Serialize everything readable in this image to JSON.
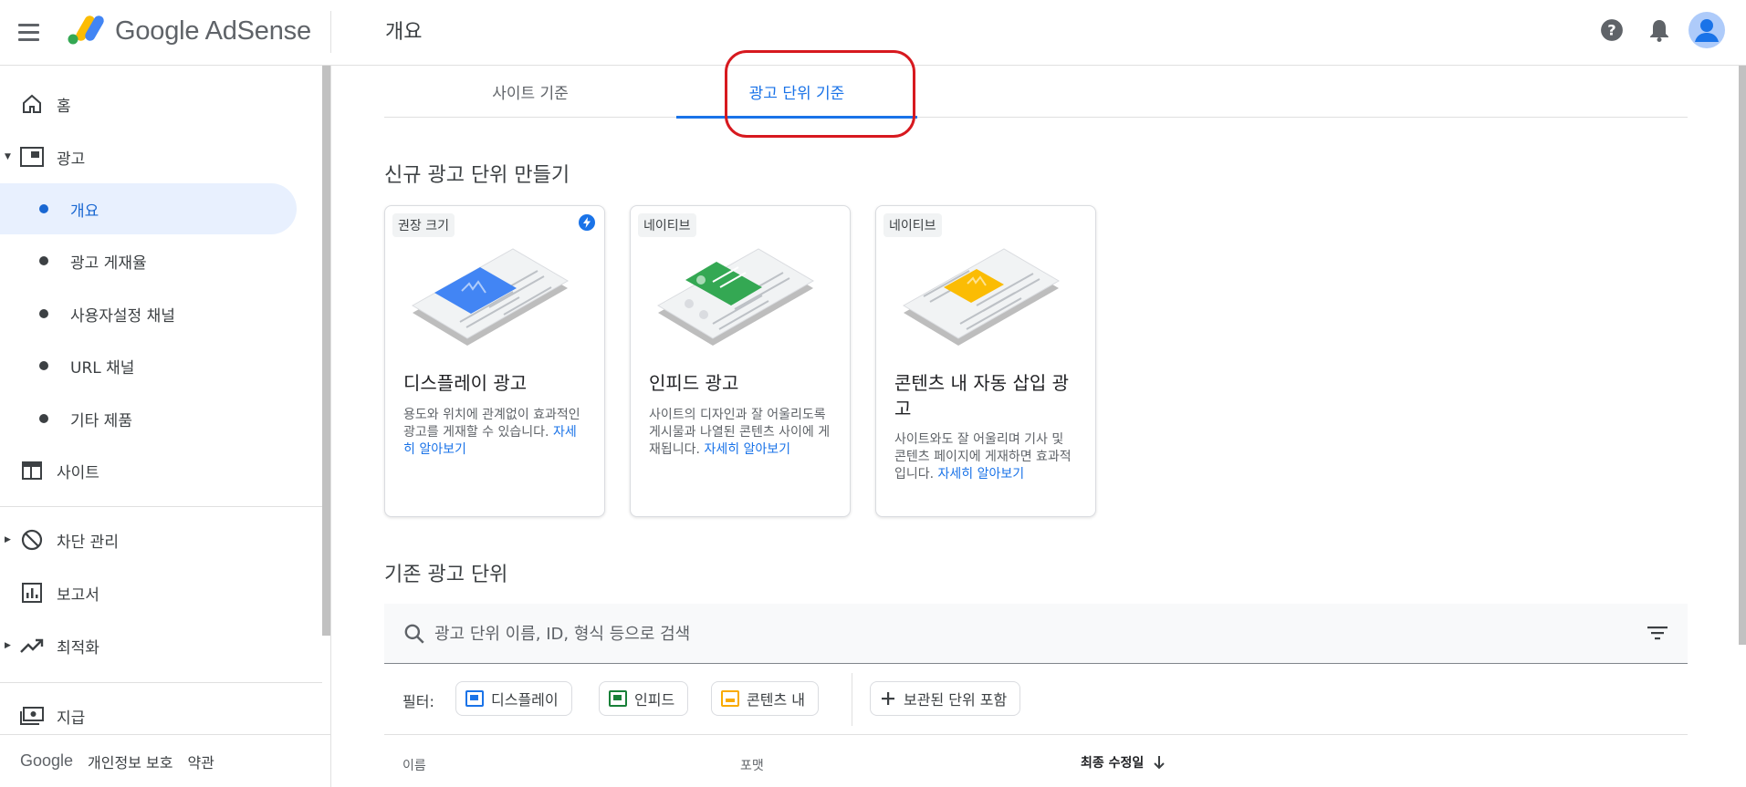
{
  "app": {
    "brand": "Google AdSense",
    "page_title": "개요"
  },
  "sidebar": {
    "home": "홈",
    "ads": "광고",
    "sub_items": [
      "개요",
      "광고 게재율",
      "사용자설정 채널",
      "URL 채널",
      "기타 제품"
    ],
    "sites": "사이트",
    "blocking": "차단 관리",
    "reports": "보고서",
    "optimization": "최적화",
    "payments": "지급",
    "footer": {
      "google": "Google",
      "privacy": "개인정보 보호",
      "terms": "약관"
    }
  },
  "tabs": [
    {
      "label": "사이트 기준",
      "active": false
    },
    {
      "label": "광고 단위 기준",
      "active": true
    }
  ],
  "create_section": {
    "title": "신규 광고 단위 만들기",
    "cards": [
      {
        "badge": "권장 크기",
        "title": "디스플레이 광고",
        "description": "용도와 위치에 관계없이 효과적인 광고를 게재할 수 있습니다.",
        "link": "자세히 알아보기",
        "accent": "#4285f4"
      },
      {
        "badge": "네이티브",
        "title": "인피드 광고",
        "description": "사이트의 디자인과 잘 어울리도록 게시물과 나열된 콘텐츠 사이에 게재됩니다.",
        "link": "자세히 알아보기",
        "accent": "#34a853"
      },
      {
        "badge": "네이티브",
        "title": "콘텐츠 내 자동 삽입 광고",
        "description": "사이트와도 잘 어울리며 기사 및 콘텐츠 페이지에 게재하면 효과적입니다.",
        "link": "자세히 알아보기",
        "accent": "#fbbc04"
      }
    ]
  },
  "existing_section": {
    "title": "기존 광고 단위",
    "search_placeholder": "광고 단위 이름, ID, 형식 등으로 검색",
    "filter_label": "필터:",
    "chips": [
      {
        "label": "디스플레이",
        "color": "#1a73e8"
      },
      {
        "label": "인피드",
        "color": "#188038"
      },
      {
        "label": "콘텐츠 내",
        "color": "#f9ab00"
      }
    ],
    "archived_chip": "보관된 단위 포함",
    "columns": [
      "이름",
      "포맷",
      "최종 수정일"
    ]
  }
}
